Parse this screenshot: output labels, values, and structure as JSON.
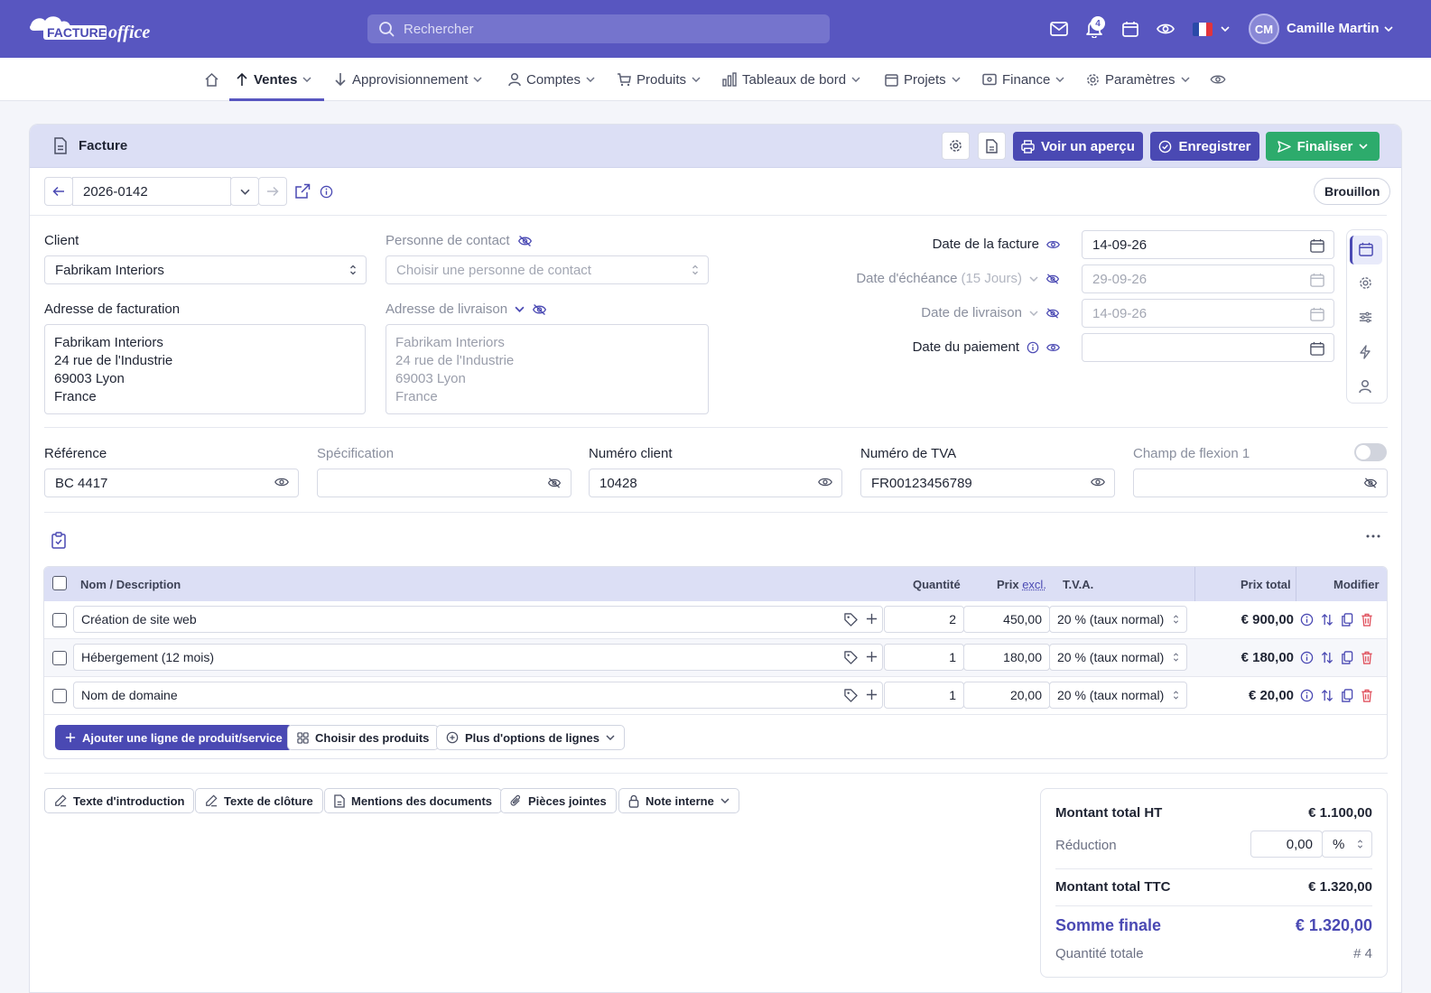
{
  "topbar": {
    "logo_text": "FACTURE office",
    "search_placeholder": "Rechercher",
    "notification_count": "4",
    "user_initials": "CM",
    "user_name": "Camille Martin"
  },
  "nav": {
    "items": [
      {
        "label": "Ventes",
        "icon": "arrow-up-icon",
        "active": true
      },
      {
        "label": "Approvisionnement",
        "icon": "arrow-down-icon"
      },
      {
        "label": "Comptes",
        "icon": "user-icon"
      },
      {
        "label": "Produits",
        "icon": "cart-icon"
      },
      {
        "label": "Tableaux de bord",
        "icon": "chart-icon"
      },
      {
        "label": "Projets",
        "icon": "folder-icon"
      },
      {
        "label": "Finance",
        "icon": "money-icon"
      },
      {
        "label": "Paramètres",
        "icon": "gear-icon"
      }
    ]
  },
  "doc": {
    "title": "Facture",
    "preview_label": "Voir un aperçu",
    "save_label": "Enregistrer",
    "finalize_label": "Finaliser",
    "number": "2026-0142",
    "status": "Brouillon"
  },
  "form": {
    "client_label": "Client",
    "client_value": "Fabrikam Interiors",
    "contact_label": "Personne de contact",
    "contact_placeholder": "Choisir une personne de contact",
    "billing_label": "Adresse de facturation",
    "billing_lines": [
      "Fabrikam Interiors",
      "24 rue de l'Industrie",
      "69003 Lyon",
      "France"
    ],
    "delivery_label": "Adresse de livraison",
    "delivery_lines": [
      "Fabrikam Interiors",
      "24 rue de l'Industrie",
      "69003 Lyon",
      "France"
    ],
    "invoice_date_label": "Date de la facture",
    "invoice_date": "14-09-26",
    "due_date_label": "Date d'échéance",
    "due_date_hint": "(15 Jours)",
    "due_date": "29-09-26",
    "delivery_date_label": "Date de livraison",
    "delivery_date": "14-09-26",
    "payment_date_label": "Date du paiement",
    "payment_date": "",
    "reference_label": "Référence",
    "reference_value": "BC 4417",
    "spec_label": "Spécification",
    "spec_value": "",
    "client_number_label": "Numéro client",
    "client_number_value": "10428",
    "vat_label": "Numéro de TVA",
    "vat_value": "FR00123456789",
    "flex_label": "Champ de flexion 1",
    "flex_value": ""
  },
  "table": {
    "headers": {
      "name": "Nom / Description",
      "qty": "Quantité",
      "price": "Prix",
      "price_suffix": "excl.",
      "vat": "T.V.A.",
      "total": "Prix total",
      "edit": "Modifier"
    },
    "rows": [
      {
        "name": "Création de site web",
        "qty": "2",
        "price": "450,00",
        "vat": "20 % (taux normal)",
        "total": "€ 900,00"
      },
      {
        "name": "Hébergement (12 mois)",
        "qty": "1",
        "price": "180,00",
        "vat": "20 % (taux normal)",
        "total": "€ 180,00"
      },
      {
        "name": "Nom de domaine",
        "qty": "1",
        "price": "20,00",
        "vat": "20 % (taux normal)",
        "total": "€ 20,00"
      }
    ],
    "add_line_label": "Ajouter une ligne de produit/service",
    "choose_products_label": "Choisir des produits",
    "more_options_label": "Plus d'options de lignes"
  },
  "bottom_buttons": {
    "intro": "Texte d'introduction",
    "closing": "Texte de clôture",
    "mentions": "Mentions des documents",
    "attachments": "Pièces jointes",
    "internal_note": "Note interne"
  },
  "summary": {
    "total_ht_label": "Montant total HT",
    "total_ht": "€ 1.100,00",
    "discount_label": "Réduction",
    "discount_value": "0,00",
    "discount_unit": "%",
    "total_ttc_label": "Montant total TTC",
    "total_ttc": "€ 1.320,00",
    "final_label": "Somme finale",
    "final_value": "€ 1.320,00",
    "qty_label": "Quantité totale",
    "qty_value": "# 4"
  },
  "colors": {
    "brand": "#5856c0",
    "primary_button": "#4a49b3",
    "finalize_button": "#2dab6c",
    "header_band": "#dcdff5",
    "delete": "#e0525e"
  }
}
